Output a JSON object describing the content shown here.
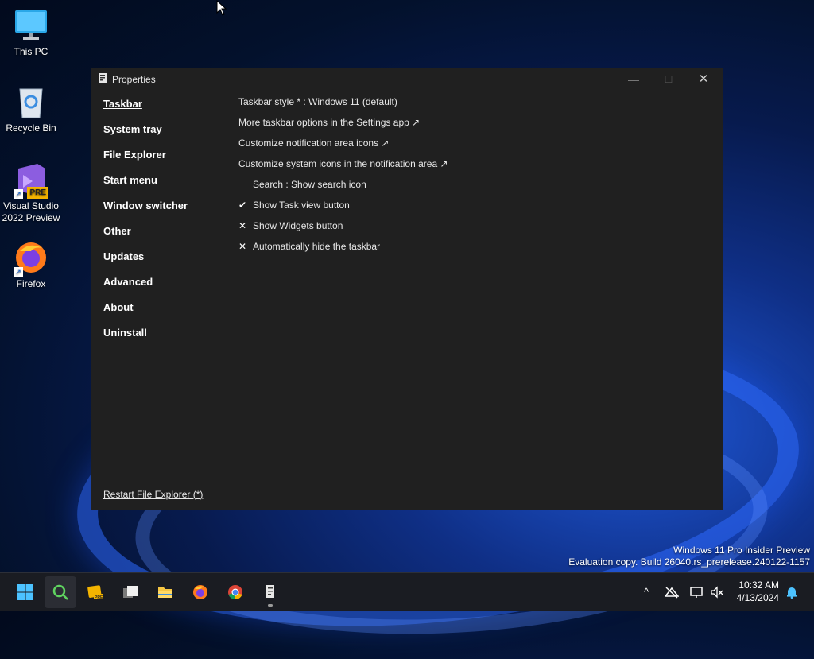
{
  "desktop": {
    "icons": [
      {
        "label": "This PC"
      },
      {
        "label": "Recycle Bin"
      },
      {
        "label": "Visual Studio 2022 Preview",
        "badge": "PRE"
      },
      {
        "label": "Firefox"
      }
    ]
  },
  "window": {
    "title": "Properties",
    "minimize_glyph": "—",
    "maximize_glyph": "☐",
    "close_glyph": "✕",
    "nav": [
      {
        "label": "Taskbar",
        "active": true
      },
      {
        "label": "System tray"
      },
      {
        "label": "File Explorer"
      },
      {
        "label": "Start menu"
      },
      {
        "label": "Window switcher"
      },
      {
        "label": "Other"
      },
      {
        "label": "Updates"
      },
      {
        "label": "Advanced"
      },
      {
        "label": "About"
      },
      {
        "label": "Uninstall"
      }
    ],
    "settings": [
      {
        "mark": "",
        "label": "Taskbar style * : Windows 11 (default)",
        "indent": false
      },
      {
        "mark": "",
        "label": "More taskbar options in the Settings app ↗",
        "indent": false
      },
      {
        "mark": "",
        "label": "Customize notification area icons ↗",
        "indent": false
      },
      {
        "mark": "",
        "label": "Customize system icons in the notification area ↗",
        "indent": false
      },
      {
        "mark": "",
        "label": "Search : Show search icon",
        "indent": true
      },
      {
        "mark": "✔",
        "label": "Show Task view button",
        "indent": true
      },
      {
        "mark": "✕",
        "label": "Show Widgets button",
        "indent": true
      },
      {
        "mark": "✕",
        "label": "Automatically hide the taskbar",
        "indent": true
      }
    ],
    "restart_link": "Restart File Explorer (*)"
  },
  "watermark": {
    "line1": "Windows 11 Pro Insider Preview",
    "line2": "Evaluation copy. Build 26040.rs_prerelease.240122-1157"
  },
  "taskbar": {
    "apps": [
      "start-icon",
      "search-icon",
      "pre-app-icon",
      "task-view-icon",
      "file-explorer-icon",
      "firefox-icon",
      "chrome-icon",
      "properties-app-icon"
    ],
    "tray_chevron": "^",
    "time": "10:32 AM",
    "date": "4/13/2024"
  },
  "colors": {
    "window_bg": "#202020",
    "taskbar_bg": "#1a1c22",
    "accent_blue": "#1f58d8"
  }
}
